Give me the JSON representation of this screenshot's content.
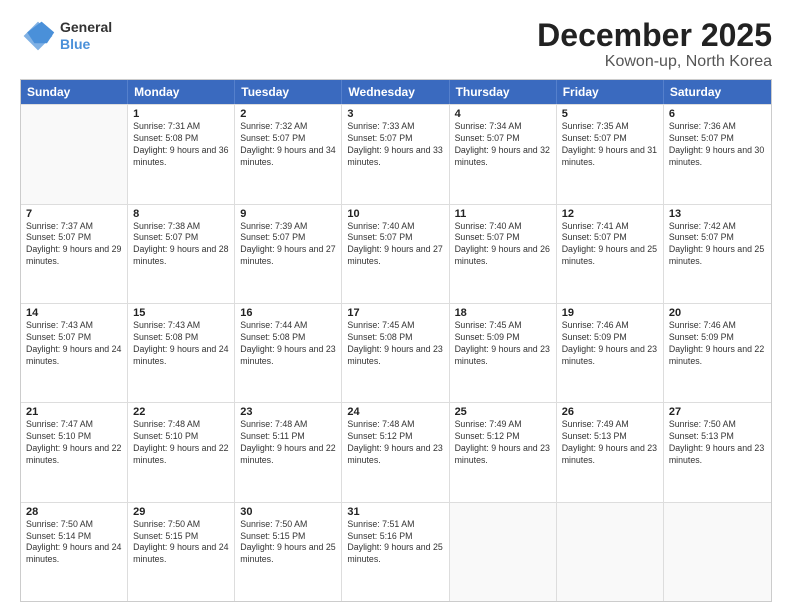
{
  "logo": {
    "line1": "General",
    "line2": "Blue"
  },
  "title": "December 2025",
  "subtitle": "Kowon-up, North Korea",
  "days_of_week": [
    "Sunday",
    "Monday",
    "Tuesday",
    "Wednesday",
    "Thursday",
    "Friday",
    "Saturday"
  ],
  "weeks": [
    [
      {
        "day": "",
        "empty": true
      },
      {
        "day": "1",
        "rise": "7:31 AM",
        "set": "5:08 PM",
        "daylight": "9 hours and 36 minutes."
      },
      {
        "day": "2",
        "rise": "7:32 AM",
        "set": "5:07 PM",
        "daylight": "9 hours and 34 minutes."
      },
      {
        "day": "3",
        "rise": "7:33 AM",
        "set": "5:07 PM",
        "daylight": "9 hours and 33 minutes."
      },
      {
        "day": "4",
        "rise": "7:34 AM",
        "set": "5:07 PM",
        "daylight": "9 hours and 32 minutes."
      },
      {
        "day": "5",
        "rise": "7:35 AM",
        "set": "5:07 PM",
        "daylight": "9 hours and 31 minutes."
      },
      {
        "day": "6",
        "rise": "7:36 AM",
        "set": "5:07 PM",
        "daylight": "9 hours and 30 minutes."
      }
    ],
    [
      {
        "day": "7",
        "rise": "7:37 AM",
        "set": "5:07 PM",
        "daylight": "9 hours and 29 minutes."
      },
      {
        "day": "8",
        "rise": "7:38 AM",
        "set": "5:07 PM",
        "daylight": "9 hours and 28 minutes."
      },
      {
        "day": "9",
        "rise": "7:39 AM",
        "set": "5:07 PM",
        "daylight": "9 hours and 27 minutes."
      },
      {
        "day": "10",
        "rise": "7:40 AM",
        "set": "5:07 PM",
        "daylight": "9 hours and 27 minutes."
      },
      {
        "day": "11",
        "rise": "7:40 AM",
        "set": "5:07 PM",
        "daylight": "9 hours and 26 minutes."
      },
      {
        "day": "12",
        "rise": "7:41 AM",
        "set": "5:07 PM",
        "daylight": "9 hours and 25 minutes."
      },
      {
        "day": "13",
        "rise": "7:42 AM",
        "set": "5:07 PM",
        "daylight": "9 hours and 25 minutes."
      }
    ],
    [
      {
        "day": "14",
        "rise": "7:43 AM",
        "set": "5:07 PM",
        "daylight": "9 hours and 24 minutes."
      },
      {
        "day": "15",
        "rise": "7:43 AM",
        "set": "5:08 PM",
        "daylight": "9 hours and 24 minutes."
      },
      {
        "day": "16",
        "rise": "7:44 AM",
        "set": "5:08 PM",
        "daylight": "9 hours and 23 minutes."
      },
      {
        "day": "17",
        "rise": "7:45 AM",
        "set": "5:08 PM",
        "daylight": "9 hours and 23 minutes."
      },
      {
        "day": "18",
        "rise": "7:45 AM",
        "set": "5:09 PM",
        "daylight": "9 hours and 23 minutes."
      },
      {
        "day": "19",
        "rise": "7:46 AM",
        "set": "5:09 PM",
        "daylight": "9 hours and 23 minutes."
      },
      {
        "day": "20",
        "rise": "7:46 AM",
        "set": "5:09 PM",
        "daylight": "9 hours and 22 minutes."
      }
    ],
    [
      {
        "day": "21",
        "rise": "7:47 AM",
        "set": "5:10 PM",
        "daylight": "9 hours and 22 minutes."
      },
      {
        "day": "22",
        "rise": "7:48 AM",
        "set": "5:10 PM",
        "daylight": "9 hours and 22 minutes."
      },
      {
        "day": "23",
        "rise": "7:48 AM",
        "set": "5:11 PM",
        "daylight": "9 hours and 22 minutes."
      },
      {
        "day": "24",
        "rise": "7:48 AM",
        "set": "5:12 PM",
        "daylight": "9 hours and 23 minutes."
      },
      {
        "day": "25",
        "rise": "7:49 AM",
        "set": "5:12 PM",
        "daylight": "9 hours and 23 minutes."
      },
      {
        "day": "26",
        "rise": "7:49 AM",
        "set": "5:13 PM",
        "daylight": "9 hours and 23 minutes."
      },
      {
        "day": "27",
        "rise": "7:50 AM",
        "set": "5:13 PM",
        "daylight": "9 hours and 23 minutes."
      }
    ],
    [
      {
        "day": "28",
        "rise": "7:50 AM",
        "set": "5:14 PM",
        "daylight": "9 hours and 24 minutes."
      },
      {
        "day": "29",
        "rise": "7:50 AM",
        "set": "5:15 PM",
        "daylight": "9 hours and 24 minutes."
      },
      {
        "day": "30",
        "rise": "7:50 AM",
        "set": "5:15 PM",
        "daylight": "9 hours and 25 minutes."
      },
      {
        "day": "31",
        "rise": "7:51 AM",
        "set": "5:16 PM",
        "daylight": "9 hours and 25 minutes."
      },
      {
        "day": "",
        "empty": true
      },
      {
        "day": "",
        "empty": true
      },
      {
        "day": "",
        "empty": true
      }
    ]
  ]
}
